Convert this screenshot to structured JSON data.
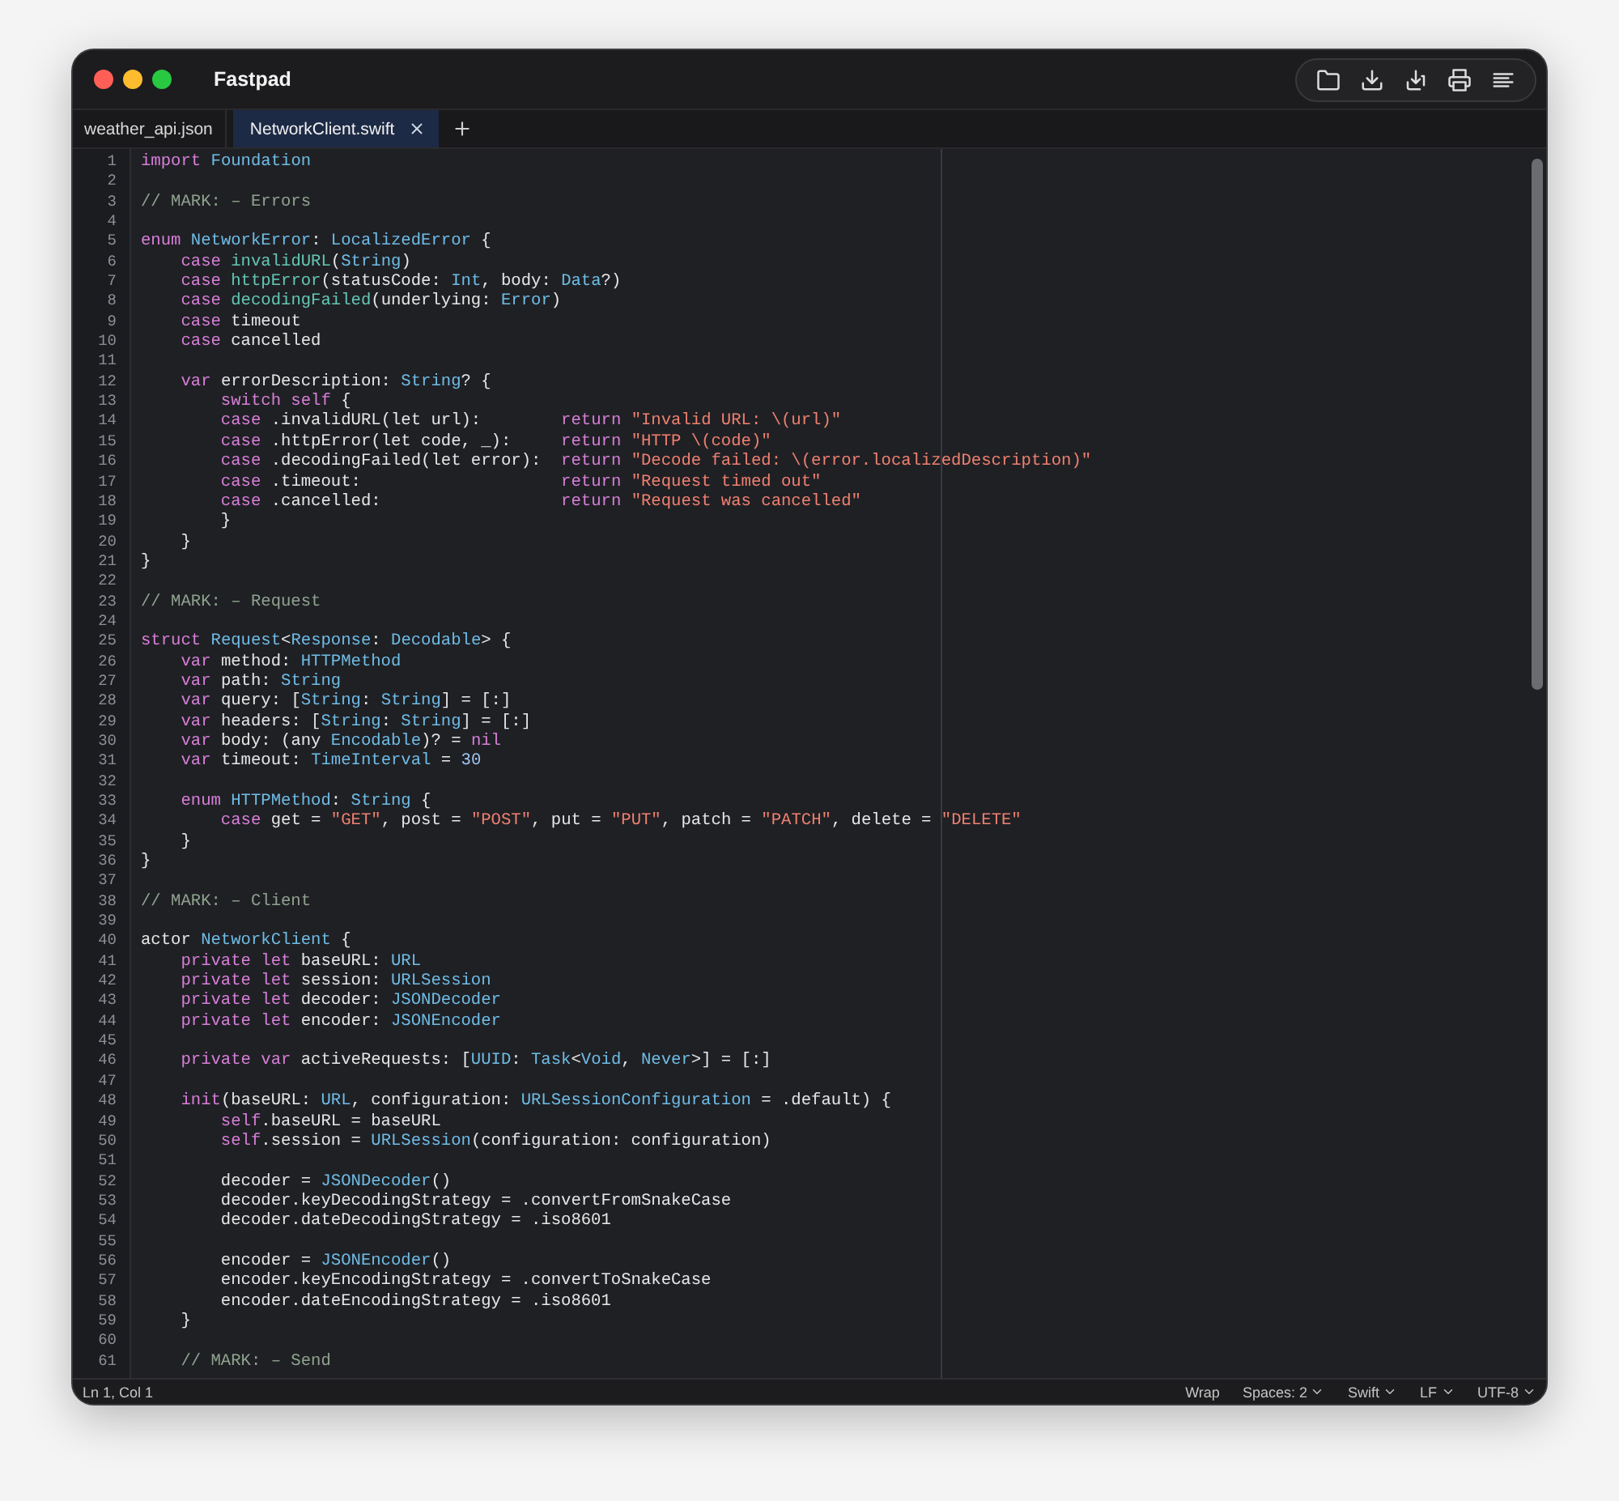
{
  "window": {
    "title": "Fastpad"
  },
  "tabs": [
    {
      "label": "weather_api.json",
      "selected": false
    },
    {
      "label": "NetworkClient.swift",
      "selected": true
    }
  ],
  "editor": {
    "lines": [
      {
        "n": "1",
        "tokens": [
          {
            "kind": "keyword",
            "text": "import "
          },
          {
            "kind": "type",
            "text": "Foundation"
          }
        ]
      },
      {
        "n": "2"
      },
      {
        "n": "3",
        "tokens": [
          {
            "kind": "comment",
            "text": "// MARK: – Errors"
          }
        ]
      },
      {
        "n": "4"
      },
      {
        "n": "5",
        "tokens": [
          {
            "kind": "keyword",
            "text": "enum "
          },
          {
            "kind": "type",
            "text": "NetworkError"
          },
          {
            "kind": "plain",
            "text": ": "
          },
          {
            "kind": "type",
            "text": "LocalizedError"
          },
          {
            "kind": "plain",
            "text": " {"
          }
        ]
      },
      {
        "n": "6",
        "tokens": [
          {
            "kind": "keyword",
            "text": "    case "
          },
          {
            "kind": "function",
            "text": "invalidURL"
          },
          {
            "kind": "plain",
            "text": "("
          },
          {
            "kind": "type",
            "text": "String"
          },
          {
            "kind": "plain",
            "text": ")"
          }
        ]
      },
      {
        "n": "7",
        "tokens": [
          {
            "kind": "keyword",
            "text": "    case "
          },
          {
            "kind": "function",
            "text": "httpError"
          },
          {
            "kind": "plain",
            "text": "(statusCode: "
          },
          {
            "kind": "type",
            "text": "Int"
          },
          {
            "kind": "plain",
            "text": ", body: "
          },
          {
            "kind": "type",
            "text": "Data"
          },
          {
            "kind": "plain",
            "text": "?)"
          }
        ]
      },
      {
        "n": "8",
        "tokens": [
          {
            "kind": "keyword",
            "text": "    case "
          },
          {
            "kind": "function",
            "text": "decodingFailed"
          },
          {
            "kind": "plain",
            "text": "(underlying: "
          },
          {
            "kind": "type",
            "text": "Error"
          },
          {
            "kind": "plain",
            "text": ")"
          }
        ]
      },
      {
        "n": "9",
        "tokens": [
          {
            "kind": "keyword",
            "text": "    case "
          },
          {
            "kind": "plain",
            "text": "timeout"
          }
        ]
      },
      {
        "n": "10",
        "tokens": [
          {
            "kind": "keyword",
            "text": "    case "
          },
          {
            "kind": "plain",
            "text": "cancelled"
          }
        ]
      },
      {
        "n": "11"
      },
      {
        "n": "12",
        "tokens": [
          {
            "kind": "keyword",
            "text": "    var "
          },
          {
            "kind": "plain",
            "text": "errorDescription: "
          },
          {
            "kind": "type",
            "text": "String"
          },
          {
            "kind": "plain",
            "text": "? {"
          }
        ]
      },
      {
        "n": "13",
        "tokens": [
          {
            "kind": "keyword",
            "text": "        switch self"
          },
          {
            "kind": "plain",
            "text": " {"
          }
        ]
      },
      {
        "n": "14",
        "tokens": [
          {
            "kind": "keyword",
            "text": "        case "
          },
          {
            "kind": "plain",
            "text": ".invalidURL(let url):        "
          },
          {
            "kind": "keyword",
            "text": "return "
          },
          {
            "kind": "string",
            "text": "\"Invalid URL: \\(url)\""
          }
        ]
      },
      {
        "n": "15",
        "tokens": [
          {
            "kind": "keyword",
            "text": "        case "
          },
          {
            "kind": "plain",
            "text": ".httpError(let code, _):     "
          },
          {
            "kind": "keyword",
            "text": "return "
          },
          {
            "kind": "string",
            "text": "\"HTTP \\(code)\""
          }
        ]
      },
      {
        "n": "16",
        "tokens": [
          {
            "kind": "keyword",
            "text": "        case "
          },
          {
            "kind": "plain",
            "text": ".decodingFailed(let error):  "
          },
          {
            "kind": "keyword",
            "text": "return "
          },
          {
            "kind": "string",
            "text": "\"Decode failed: \\(error.localizedDescription)\""
          }
        ]
      },
      {
        "n": "17",
        "tokens": [
          {
            "kind": "keyword",
            "text": "        case "
          },
          {
            "kind": "plain",
            "text": ".timeout:                    "
          },
          {
            "kind": "keyword",
            "text": "return "
          },
          {
            "kind": "string",
            "text": "\"Request timed out\""
          }
        ]
      },
      {
        "n": "18",
        "tokens": [
          {
            "kind": "keyword",
            "text": "        case "
          },
          {
            "kind": "plain",
            "text": ".cancelled:                  "
          },
          {
            "kind": "keyword",
            "text": "return "
          },
          {
            "kind": "string",
            "text": "\"Request was cancelled\""
          }
        ]
      },
      {
        "n": "19",
        "tokens": [
          {
            "kind": "plain",
            "text": "        }"
          }
        ]
      },
      {
        "n": "20",
        "tokens": [
          {
            "kind": "plain",
            "text": "    }"
          }
        ]
      },
      {
        "n": "21",
        "tokens": [
          {
            "kind": "plain",
            "text": "}"
          }
        ]
      },
      {
        "n": "22"
      },
      {
        "n": "23",
        "tokens": [
          {
            "kind": "comment",
            "text": "// MARK: – Request"
          }
        ]
      },
      {
        "n": "24"
      },
      {
        "n": "25",
        "tokens": [
          {
            "kind": "keyword",
            "text": "struct "
          },
          {
            "kind": "type",
            "text": "Request"
          },
          {
            "kind": "plain",
            "text": "<"
          },
          {
            "kind": "type",
            "text": "Response"
          },
          {
            "kind": "plain",
            "text": ": "
          },
          {
            "kind": "type",
            "text": "Decodable"
          },
          {
            "kind": "plain",
            "text": "> {"
          }
        ]
      },
      {
        "n": "26",
        "tokens": [
          {
            "kind": "keyword",
            "text": "    var "
          },
          {
            "kind": "plain",
            "text": "method: "
          },
          {
            "kind": "type",
            "text": "HTTPMethod"
          }
        ]
      },
      {
        "n": "27",
        "tokens": [
          {
            "kind": "keyword",
            "text": "    var "
          },
          {
            "kind": "plain",
            "text": "path: "
          },
          {
            "kind": "type",
            "text": "String"
          }
        ]
      },
      {
        "n": "28",
        "tokens": [
          {
            "kind": "keyword",
            "text": "    var "
          },
          {
            "kind": "plain",
            "text": "query: ["
          },
          {
            "kind": "type",
            "text": "String"
          },
          {
            "kind": "plain",
            "text": ": "
          },
          {
            "kind": "type",
            "text": "String"
          },
          {
            "kind": "plain",
            "text": "] = [:]"
          }
        ]
      },
      {
        "n": "29",
        "tokens": [
          {
            "kind": "keyword",
            "text": "    var "
          },
          {
            "kind": "plain",
            "text": "headers: ["
          },
          {
            "kind": "type",
            "text": "String"
          },
          {
            "kind": "plain",
            "text": ": "
          },
          {
            "kind": "type",
            "text": "String"
          },
          {
            "kind": "plain",
            "text": "] = [:]"
          }
        ]
      },
      {
        "n": "30",
        "tokens": [
          {
            "kind": "keyword",
            "text": "    var "
          },
          {
            "kind": "plain",
            "text": "body: (any "
          },
          {
            "kind": "type",
            "text": "Encodable"
          },
          {
            "kind": "plain",
            "text": ")? = "
          },
          {
            "kind": "keyword",
            "text": "nil"
          }
        ]
      },
      {
        "n": "31",
        "tokens": [
          {
            "kind": "keyword",
            "text": "    var "
          },
          {
            "kind": "plain",
            "text": "timeout: "
          },
          {
            "kind": "type",
            "text": "TimeInterval"
          },
          {
            "kind": "plain",
            "text": " = "
          },
          {
            "kind": "number",
            "text": "30"
          }
        ]
      },
      {
        "n": "32"
      },
      {
        "n": "33",
        "tokens": [
          {
            "kind": "keyword",
            "text": "    enum "
          },
          {
            "kind": "type",
            "text": "HTTPMethod"
          },
          {
            "kind": "plain",
            "text": ": "
          },
          {
            "kind": "type",
            "text": "String"
          },
          {
            "kind": "plain",
            "text": " {"
          }
        ]
      },
      {
        "n": "34",
        "tokens": [
          {
            "kind": "keyword",
            "text": "        case "
          },
          {
            "kind": "plain",
            "text": "get = "
          },
          {
            "kind": "string",
            "text": "\"GET\""
          },
          {
            "kind": "plain",
            "text": ", post = "
          },
          {
            "kind": "string",
            "text": "\"POST\""
          },
          {
            "kind": "plain",
            "text": ", put = "
          },
          {
            "kind": "string",
            "text": "\"PUT\""
          },
          {
            "kind": "plain",
            "text": ", patch = "
          },
          {
            "kind": "string",
            "text": "\"PATCH\""
          },
          {
            "kind": "plain",
            "text": ", delete = "
          },
          {
            "kind": "string",
            "text": "\"DELETE\""
          }
        ]
      },
      {
        "n": "35",
        "tokens": [
          {
            "kind": "plain",
            "text": "    }"
          }
        ]
      },
      {
        "n": "36",
        "tokens": [
          {
            "kind": "plain",
            "text": "}"
          }
        ]
      },
      {
        "n": "37"
      },
      {
        "n": "38",
        "tokens": [
          {
            "kind": "comment",
            "text": "// MARK: – Client"
          }
        ]
      },
      {
        "n": "39"
      },
      {
        "n": "40",
        "tokens": [
          {
            "kind": "plain",
            "text": "actor "
          },
          {
            "kind": "type",
            "text": "NetworkClient"
          },
          {
            "kind": "plain",
            "text": " {"
          }
        ]
      },
      {
        "n": "41",
        "tokens": [
          {
            "kind": "keyword",
            "text": "    private let "
          },
          {
            "kind": "plain",
            "text": "baseURL: "
          },
          {
            "kind": "type",
            "text": "URL"
          }
        ]
      },
      {
        "n": "42",
        "tokens": [
          {
            "kind": "keyword",
            "text": "    private let "
          },
          {
            "kind": "plain",
            "text": "session: "
          },
          {
            "kind": "type",
            "text": "URLSession"
          }
        ]
      },
      {
        "n": "43",
        "tokens": [
          {
            "kind": "keyword",
            "text": "    private let "
          },
          {
            "kind": "plain",
            "text": "decoder: "
          },
          {
            "kind": "type",
            "text": "JSONDecoder"
          }
        ]
      },
      {
        "n": "44",
        "tokens": [
          {
            "kind": "keyword",
            "text": "    private let "
          },
          {
            "kind": "plain",
            "text": "encoder: "
          },
          {
            "kind": "type",
            "text": "JSONEncoder"
          }
        ]
      },
      {
        "n": "45"
      },
      {
        "n": "46",
        "tokens": [
          {
            "kind": "keyword",
            "text": "    private var "
          },
          {
            "kind": "plain",
            "text": "activeRequests: ["
          },
          {
            "kind": "type",
            "text": "UUID"
          },
          {
            "kind": "plain",
            "text": ": "
          },
          {
            "kind": "type",
            "text": "Task"
          },
          {
            "kind": "plain",
            "text": "<"
          },
          {
            "kind": "type",
            "text": "Void"
          },
          {
            "kind": "plain",
            "text": ", "
          },
          {
            "kind": "type",
            "text": "Never"
          },
          {
            "kind": "plain",
            "text": ">] = [:]"
          }
        ]
      },
      {
        "n": "47"
      },
      {
        "n": "48",
        "tokens": [
          {
            "kind": "keyword",
            "text": "    init"
          },
          {
            "kind": "plain",
            "text": "(baseURL: "
          },
          {
            "kind": "type",
            "text": "URL"
          },
          {
            "kind": "plain",
            "text": ", configuration: "
          },
          {
            "kind": "type",
            "text": "URLSessionConfiguration"
          },
          {
            "kind": "plain",
            "text": " = .default) {"
          }
        ]
      },
      {
        "n": "49",
        "tokens": [
          {
            "kind": "keyword",
            "text": "        self"
          },
          {
            "kind": "plain",
            "text": ".baseURL = baseURL"
          }
        ]
      },
      {
        "n": "50",
        "tokens": [
          {
            "kind": "keyword",
            "text": "        self"
          },
          {
            "kind": "plain",
            "text": ".session = "
          },
          {
            "kind": "type",
            "text": "URLSession"
          },
          {
            "kind": "plain",
            "text": "(configuration: configuration)"
          }
        ]
      },
      {
        "n": "51"
      },
      {
        "n": "52",
        "tokens": [
          {
            "kind": "plain",
            "text": "        decoder = "
          },
          {
            "kind": "type",
            "text": "JSONDecoder"
          },
          {
            "kind": "plain",
            "text": "()"
          }
        ]
      },
      {
        "n": "53",
        "tokens": [
          {
            "kind": "plain",
            "text": "        decoder.keyDecodingStrategy = .convertFromSnakeCase"
          }
        ]
      },
      {
        "n": "54",
        "tokens": [
          {
            "kind": "plain",
            "text": "        decoder.dateDecodingStrategy = .iso8601"
          }
        ]
      },
      {
        "n": "55"
      },
      {
        "n": "56",
        "tokens": [
          {
            "kind": "plain",
            "text": "        encoder = "
          },
          {
            "kind": "type",
            "text": "JSONEncoder"
          },
          {
            "kind": "plain",
            "text": "()"
          }
        ]
      },
      {
        "n": "57",
        "tokens": [
          {
            "kind": "plain",
            "text": "        encoder.keyEncodingStrategy = .convertToSnakeCase"
          }
        ]
      },
      {
        "n": "58",
        "tokens": [
          {
            "kind": "plain",
            "text": "        encoder.dateEncodingStrategy = .iso8601"
          }
        ]
      },
      {
        "n": "59",
        "tokens": [
          {
            "kind": "plain",
            "text": "    }"
          }
        ]
      },
      {
        "n": "60"
      },
      {
        "n": "61",
        "tokens": [
          {
            "kind": "comment",
            "text": "    // MARK: – Send"
          }
        ]
      }
    ]
  },
  "status_bar": {
    "position": "Ln 1, Col 1",
    "items": [
      {
        "label": "Wrap",
        "kind": "toggle"
      },
      {
        "label": "Spaces: 2",
        "kind": "menu"
      },
      {
        "label": "Swift",
        "kind": "menu"
      },
      {
        "label": "LF",
        "kind": "menu"
      },
      {
        "label": "UTF-8",
        "kind": "menu"
      }
    ]
  }
}
